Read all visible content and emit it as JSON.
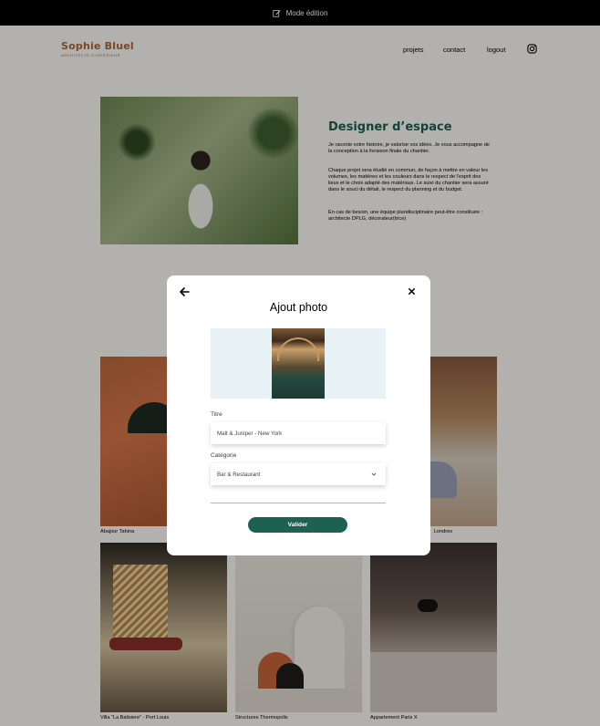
{
  "edit_bar": {
    "label": "Mode édition",
    "icon": "edit-icon"
  },
  "header": {
    "logo_title": "Sophie Bluel",
    "logo_subtitle": "ARCHITECTE D'INTÉRIEUR",
    "nav": [
      "projets",
      "contact",
      "logout"
    ],
    "instagram_icon": "instagram-icon"
  },
  "intro": {
    "title": "Designer d’espace",
    "paragraphs": [
      "Je raconte votre histoire, je valorise vos idées. Je vous accompagne de la conception à la livraison finale du chantier.",
      "Chaque projet sera étudié en commun, de façon à mettre en valeur les volumes, les matières et les couleurs dans le respect de l’esprit des lieux et le choix adapté des matériaux. Le suivi du chantier sera assuré dans le souci du détail, le respect du planning et du budget.",
      "En cas de besoin, une équipe pluridisciplinaire peut-être constituée : architecte DPLG, décorateur(trice)"
    ]
  },
  "gallery": {
    "captions": [
      "Abajour Tahina",
      "Londres",
      "Villa “La Balisiere” - Port Louis",
      "Structures Thermopolis",
      "Appartement Paris X"
    ]
  },
  "modal": {
    "title": "Ajout photo",
    "back_icon": "arrow-left-icon",
    "close_icon": "close-icon",
    "title_label": "Titre",
    "title_value": "Malt & Juniper - New York",
    "category_label": "Catégorie",
    "category_value": "Bar & Restaurant",
    "submit_label": "Valider"
  },
  "colors": {
    "brand": "#b1663c",
    "accent": "#1d6154",
    "edit_bar": "#000000",
    "preview_bg": "#e8f1f6"
  }
}
